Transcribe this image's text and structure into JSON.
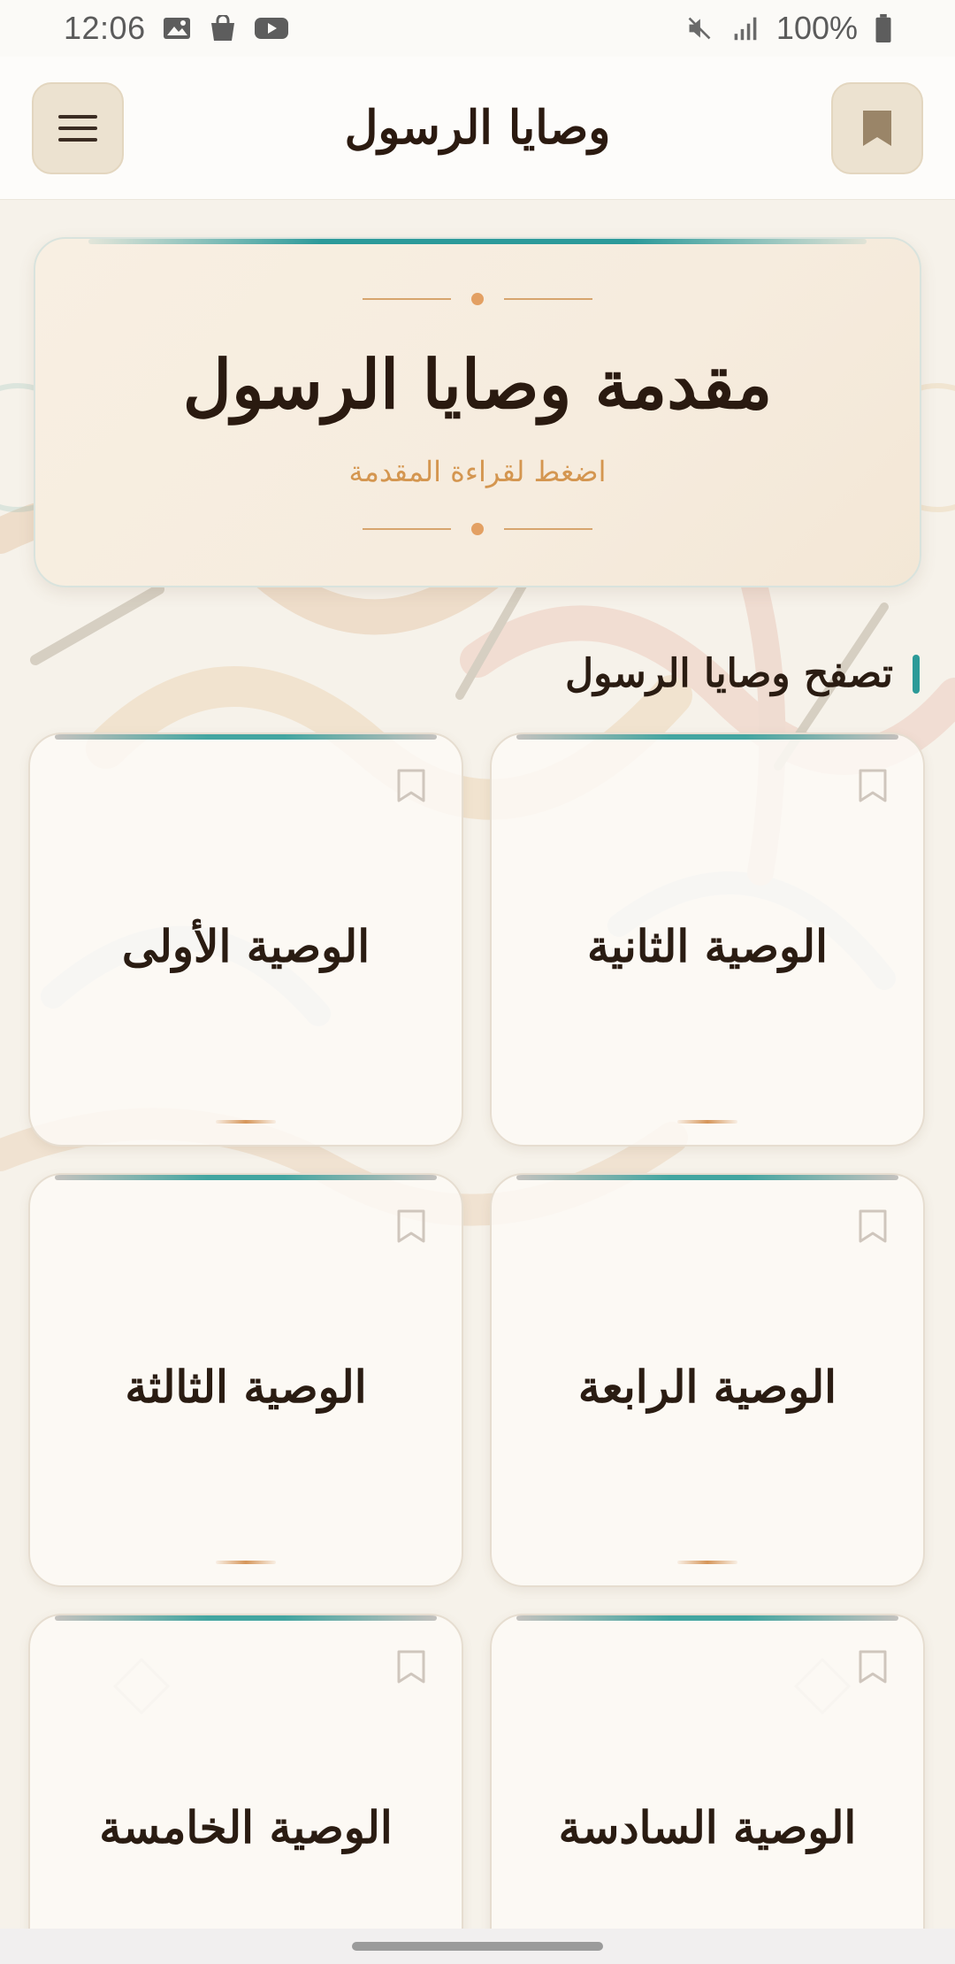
{
  "status_bar": {
    "time": "12:06",
    "battery": "100%",
    "left_icons": [
      "image-icon",
      "bag-icon",
      "youtube-icon"
    ],
    "right_icons": [
      "mute-icon",
      "signal-icon",
      "battery-icon"
    ]
  },
  "app_bar": {
    "title": "وصايا الرسول",
    "menu_icon": "menu-icon",
    "bookmark_icon": "bookmark-icon"
  },
  "intro_card": {
    "title": "مقدمة وصايا الرسول",
    "subtitle": "اضغط لقراءة المقدمة"
  },
  "section": {
    "title": "تصفح وصايا الرسول"
  },
  "cards": [
    {
      "label": "الوصية الثانية",
      "bookmark_icon": "bookmark-outline-icon"
    },
    {
      "label": "الوصية الأولى",
      "bookmark_icon": "bookmark-outline-icon"
    },
    {
      "label": "الوصية الرابعة",
      "bookmark_icon": "bookmark-outline-icon"
    },
    {
      "label": "الوصية الثالثة",
      "bookmark_icon": "bookmark-outline-icon"
    },
    {
      "label": "الوصية السادسة",
      "bookmark_icon": "bookmark-outline-icon"
    },
    {
      "label": "الوصية الخامسة",
      "bookmark_icon": "bookmark-outline-icon"
    }
  ],
  "colors": {
    "accent_teal": "#2c9a9a",
    "accent_orange": "#d49650",
    "button_bg": "#ece2d0",
    "bookmark_fill": "#9a8568"
  }
}
